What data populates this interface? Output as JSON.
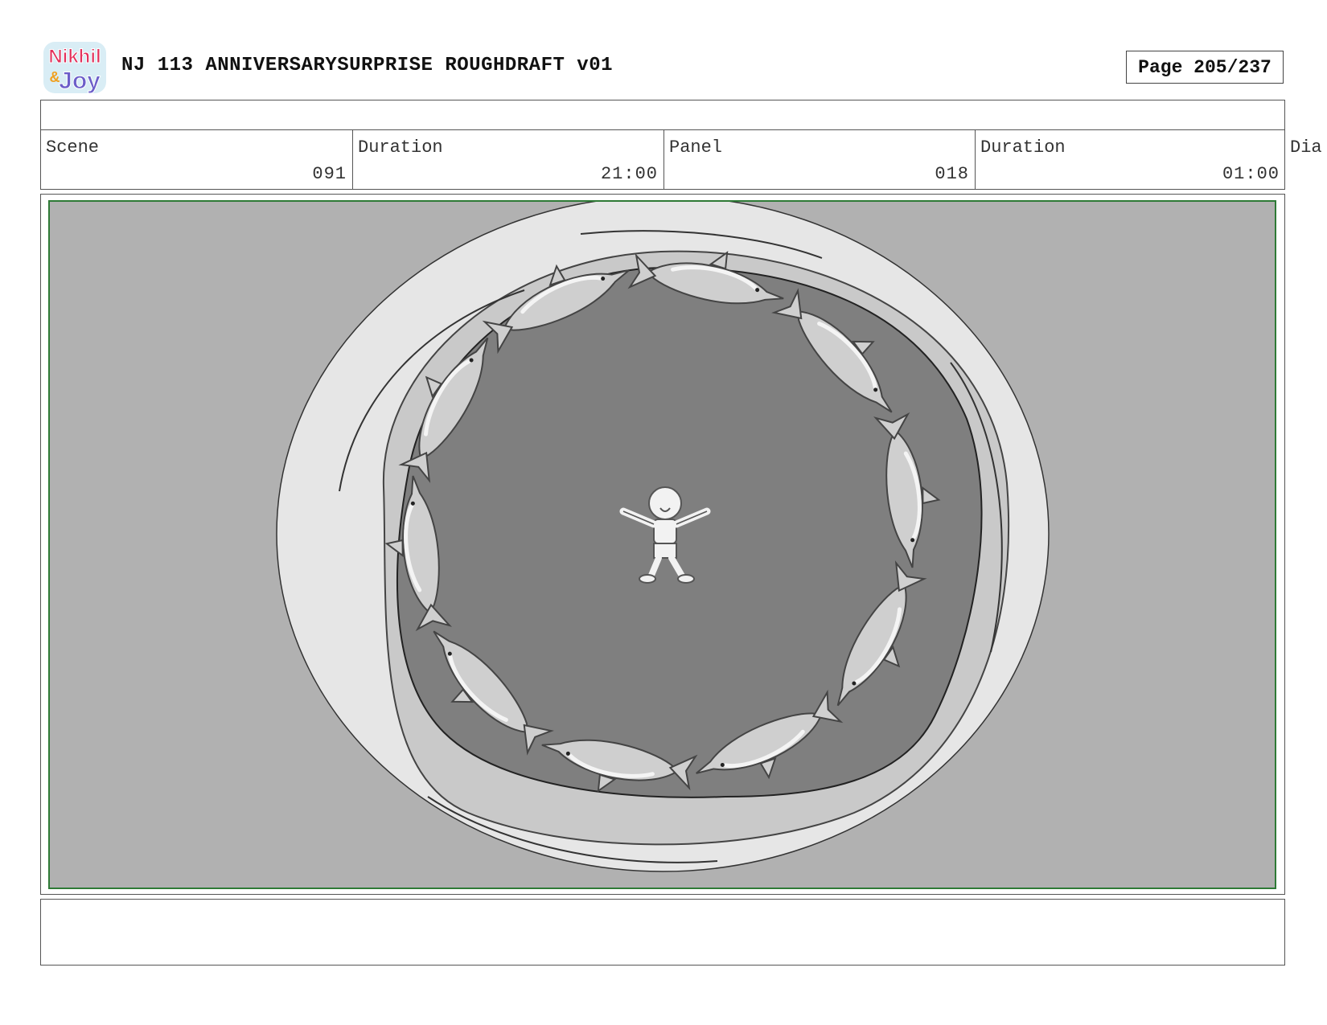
{
  "header": {
    "logo_text_top": "Nikhil",
    "logo_text_amp": "&",
    "logo_text_bottom": "Joy",
    "title": "NJ 113 ANNIVERSARYSURPRISE ROUGHDRAFT v01",
    "page_label": "Page 205/237"
  },
  "info": {
    "scene_label": "Scene",
    "scene_value": "091",
    "scene_duration_label": "Duration",
    "scene_duration_value": "21:00",
    "panel_label": "Panel",
    "panel_value": "018",
    "panel_duration_label": "Duration",
    "panel_duration_value": "01:00",
    "dialogue_label": "Dia"
  },
  "panel": {
    "image_subject": "overhead-pool-dolphin-circle",
    "frame_color": "#2e7a36",
    "background_color": "#b1b1b1"
  },
  "notes": {
    "text": ""
  }
}
